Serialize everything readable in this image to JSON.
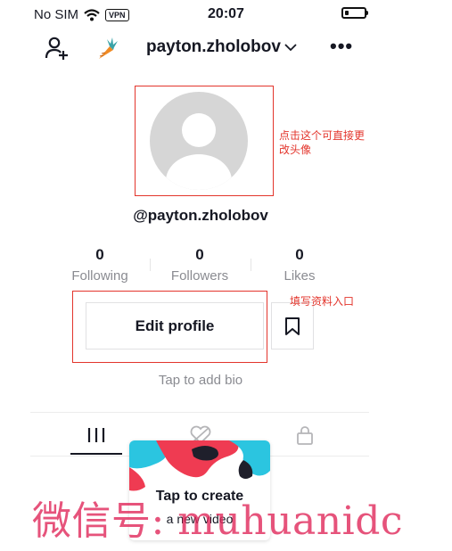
{
  "status_bar": {
    "carrier": "No SIM",
    "vpn": "VPN",
    "time": "20:07",
    "battery_percent": 20
  },
  "header": {
    "username": "payton.zholobov",
    "add_friend_icon": "person-plus-icon",
    "logo_icon": "carrot-logo-icon",
    "more_icon": "ellipsis-icon"
  },
  "profile": {
    "handle": "@payton.zholobov",
    "avatar_icon": "default-avatar-icon"
  },
  "annotations": {
    "avatar_note_line1": "点击这个可直接更",
    "avatar_note_line2": "改头像",
    "edit_note": "填写资料入口"
  },
  "stats": [
    {
      "value": "0",
      "label": "Following"
    },
    {
      "value": "0",
      "label": "Followers"
    },
    {
      "value": "0",
      "label": "Likes"
    }
  ],
  "actions": {
    "edit_profile_label": "Edit profile",
    "bookmark_icon": "bookmark-icon"
  },
  "bio": {
    "placeholder": "Tap to add bio"
  },
  "tabs": [
    {
      "name": "videos",
      "icon": "grid-icon",
      "active": true
    },
    {
      "name": "liked",
      "icon": "heart-hidden-icon",
      "active": false
    },
    {
      "name": "private",
      "icon": "lock-icon",
      "active": false
    }
  ],
  "create_tooltip": {
    "title": "Tap to create",
    "subtitle": "a new video"
  },
  "watermark": {
    "text": "微信号: muhuanidc"
  },
  "colors": {
    "annotation_red": "#e3352c",
    "watermark": "#e0285a",
    "text_primary": "#161823",
    "text_secondary": "#8a8b91"
  }
}
